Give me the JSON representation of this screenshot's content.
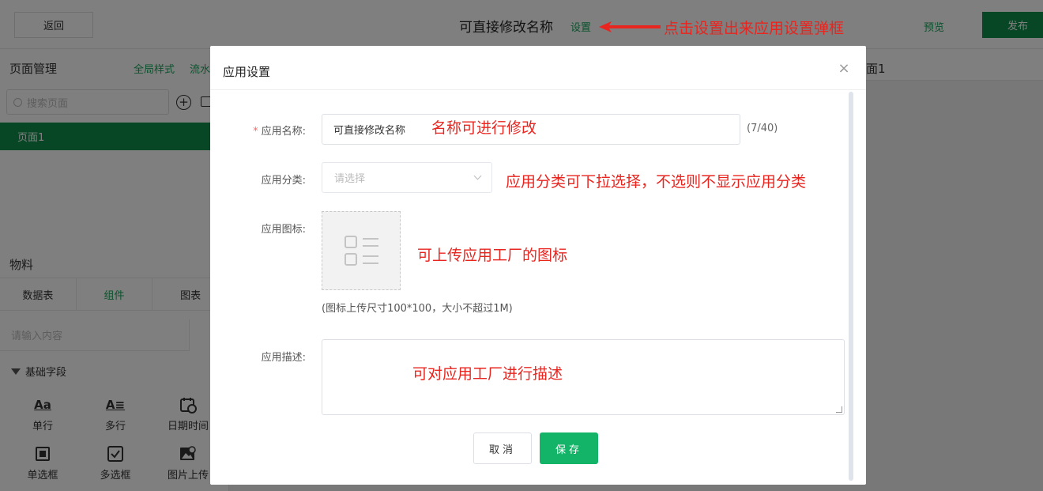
{
  "topbar": {
    "back_label": "返回",
    "app_title": "可直接修改名称",
    "settings_label": "设置",
    "preview_label": "预览",
    "publish_label": "发布"
  },
  "sidebar": {
    "page_mgmt_title": "页面管理",
    "global_style_label": "全局样式",
    "flow_label": "流水",
    "search_placeholder": "搜索页面",
    "pages": [
      {
        "label": "页面1"
      }
    ],
    "material_title": "物料",
    "material_tabs": [
      {
        "label": "数据表"
      },
      {
        "label": "组件"
      },
      {
        "label": "图表"
      }
    ],
    "material_search_placeholder": "请输入内容",
    "basic_fields_title": "基础字段",
    "fields": [
      {
        "label": "单行",
        "icon": "Aa"
      },
      {
        "label": "多行",
        "icon": "A≡"
      },
      {
        "label": "日期时间",
        "icon": "calendar-icon"
      },
      {
        "label": "单选框",
        "icon": "radio-icon"
      },
      {
        "label": "多选框",
        "icon": "checkbox-icon"
      },
      {
        "label": "图片上传",
        "icon": "image-upload-icon"
      }
    ]
  },
  "canvas": {
    "page_tab_label": "面1"
  },
  "modal": {
    "title": "应用设置",
    "close_glyph": "×",
    "name_label": "应用名称:",
    "name_required_mark": "*",
    "name_value": "可直接修改名称",
    "name_counter": "(7/40)",
    "category_label": "应用分类:",
    "category_placeholder": "请选择",
    "icon_label": "应用图标:",
    "icon_hint": "(图标上传尺寸100*100，大小不超过1M)",
    "desc_label": "应用描述:",
    "cancel_label": "取消",
    "save_label": "保存"
  },
  "annotations": {
    "settings_note": "点击设置出来应用设置弹框",
    "name_note": "名称可进行修改",
    "category_note": "应用分类可下拉选择，不选则不显示应用分类",
    "icon_note": "可上传应用工厂的图标",
    "desc_note": "可对应用工厂进行描述"
  },
  "colors": {
    "brand_green": "#0f8f4b",
    "save_green": "#13b467",
    "link_green": "#17a55a",
    "annotation_red": "#e8251f"
  }
}
